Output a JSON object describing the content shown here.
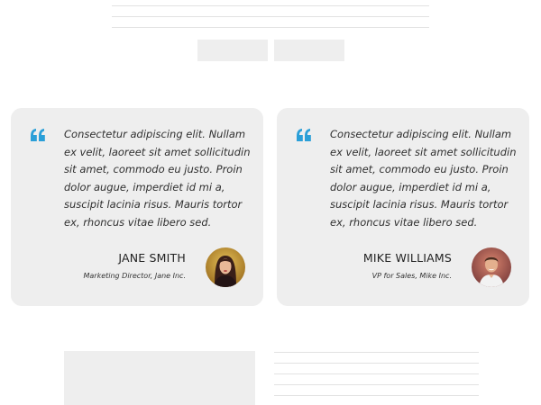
{
  "testimonials": [
    {
      "quote": "Consectetur adipiscing elit. Nullam ex velit, laoreet sit amet sollicitudin sit amet, commodo eu justo. Proin dolor augue, imperdiet id mi a, suscipit lacinia risus. Mauris tortor ex, rhoncus vitae libero sed.",
      "name": "JANE SMITH",
      "role": "Marketing Director, Jane Inc.",
      "avatar_icon": "woman-portrait-icon"
    },
    {
      "quote": "Consectetur adipiscing elit. Nullam ex velit, laoreet sit amet sollicitudin sit amet, commodo eu justo. Proin dolor augue, imperdiet id mi a, suscipit lacinia risus. Mauris tortor ex, rhoncus vitae libero sed.",
      "name": "MIKE WILLIAMS",
      "role": "VP for Sales, Mike Inc.",
      "avatar_icon": "man-portrait-icon"
    }
  ],
  "colors": {
    "accent": "#2a9fd8",
    "card_background": "#eeeeee",
    "placeholder": "#eeeeee",
    "line": "#e2e2e2"
  },
  "icons": {
    "quote": "quote-icon"
  }
}
